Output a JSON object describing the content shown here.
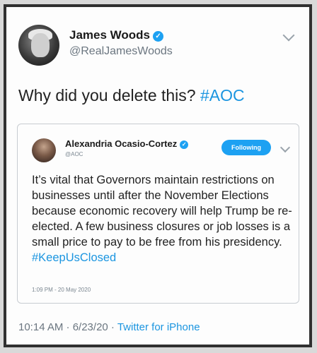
{
  "tweet": {
    "author_name": "James Woods",
    "author_handle": "@RealJamesWoods",
    "text": "Why did you delete this?",
    "hashtag": "#AOC",
    "timestamp": "10:14 AM · 6/23/20 · ",
    "source": "Twitter for iPhone"
  },
  "quoted": {
    "author_name": "Alexandria Ocasio-Cortez",
    "author_handle": "@AOC",
    "follow_label": "Following",
    "text": "It’s vital that Governors maintain restrictions on businesses until after the November Elections because economic recovery will help Trump be re-elected. A few business closures or job losses is a small price to pay to be free from his presidency.",
    "hashtag": "#KeepUsClosed",
    "timestamp": "1:09 PM - 20 May 2020"
  },
  "icons": [
    "verified-badge-icon",
    "chevron-down-icon"
  ],
  "colors": {
    "link": "#1b95e0",
    "verified": "#1da1f2",
    "secondary_text": "#6b7680"
  }
}
